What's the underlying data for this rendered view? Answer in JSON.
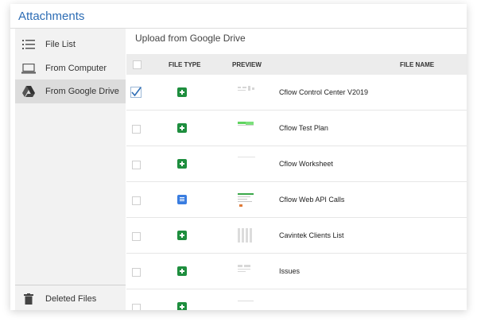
{
  "header": {
    "title": "Attachments"
  },
  "sidebar": {
    "items": [
      {
        "label": "File List",
        "icon": "list-icon"
      },
      {
        "label": "From Computer",
        "icon": "laptop-icon"
      },
      {
        "label": "From Google Drive",
        "icon": "google-drive-icon",
        "active": true
      }
    ],
    "bottom_item": {
      "label": "Deleted Files",
      "icon": "trash-icon"
    }
  },
  "main": {
    "title": "Upload from Google Drive",
    "columns": [
      "FILE TYPE",
      "PREVIEW",
      "FILE NAME"
    ],
    "rows": [
      {
        "type": "sheet",
        "name": "Cflow Control Center V2019",
        "checked": true
      },
      {
        "type": "sheet",
        "name": "Cflow Test Plan",
        "checked": false
      },
      {
        "type": "sheet",
        "name": "Cflow Worksheet",
        "checked": false
      },
      {
        "type": "doc",
        "name": "Cflow Web API Calls",
        "checked": false
      },
      {
        "type": "sheet",
        "name": "Cavintek Clients List",
        "checked": false
      },
      {
        "type": "sheet",
        "name": "Issues",
        "checked": false
      }
    ]
  },
  "colors": {
    "accent": "#2d6db5",
    "sheet": "#1e8e3e",
    "doc": "#3a7de0"
  }
}
